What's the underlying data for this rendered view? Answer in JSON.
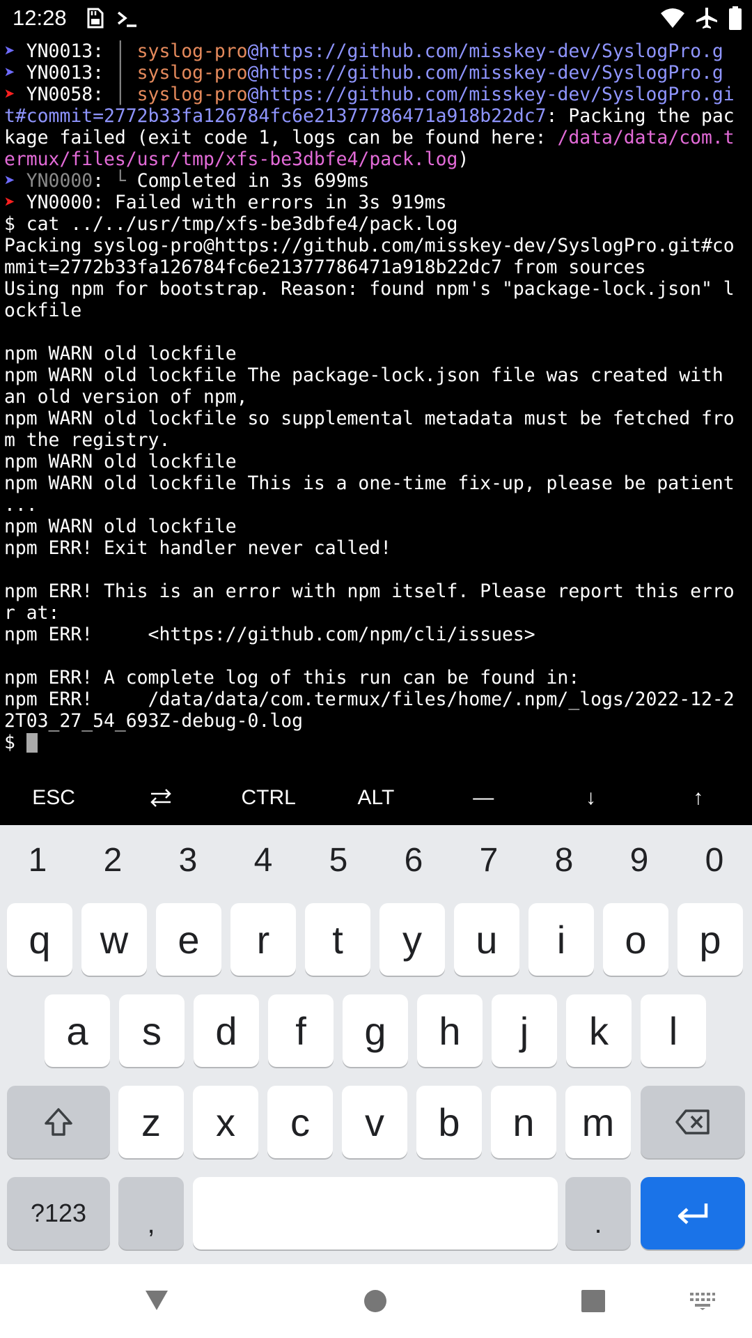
{
  "status_bar": {
    "time": "12:28",
    "left_icons": [
      "sd-card-icon",
      "terminal-prompt-icon"
    ],
    "right_icons": [
      "wifi-icon",
      "airplane-mode-icon",
      "battery-icon"
    ]
  },
  "terminal": {
    "lines": [
      [
        {
          "t": "➤ ",
          "c": "blue"
        },
        {
          "t": "YN0013: "
        },
        {
          "t": "│ ",
          "c": "gray"
        },
        {
          "t": "syslog-pro",
          "c": "orange"
        },
        {
          "t": "@https://github.com/misskey-dev/SyslogPro.g",
          "c": "link"
        }
      ],
      [
        {
          "t": "➤ ",
          "c": "blue"
        },
        {
          "t": "YN0013: "
        },
        {
          "t": "│ ",
          "c": "gray"
        },
        {
          "t": "syslog-pro",
          "c": "orange"
        },
        {
          "t": "@https://github.com/misskey-dev/SyslogPro.g",
          "c": "link"
        }
      ],
      [
        {
          "t": "➤ ",
          "c": "red"
        },
        {
          "t": "YN0058: "
        },
        {
          "t": "│ ",
          "c": "gray"
        },
        {
          "t": "syslog-pro",
          "c": "orange"
        },
        {
          "t": "@https://github.com/misskey-dev/SyslogPro.gi",
          "c": "link"
        }
      ],
      [
        {
          "t": "t#commit=2772b33fa126784fc6e21377786471a918b22dc7",
          "c": "link"
        },
        {
          "t": ": Packing the pac"
        }
      ],
      [
        {
          "t": "kage failed (exit code 1, logs can be found here: "
        },
        {
          "t": "/data/data/com.t",
          "c": "magenta"
        }
      ],
      [
        {
          "t": "ermux/files/usr/tmp/xfs-be3dbfe4/pack.log",
          "c": "magenta"
        },
        {
          "t": ")"
        }
      ],
      [
        {
          "t": "➤ ",
          "c": "blue"
        },
        {
          "t": "YN0000",
          "c": "gray"
        },
        {
          "t": ": "
        },
        {
          "t": "└ ",
          "c": "gray"
        },
        {
          "t": "Completed in 3s 699ms"
        }
      ],
      [
        {
          "t": "➤ ",
          "c": "red"
        },
        {
          "t": "YN0000: Failed with errors in 3s 919ms"
        }
      ],
      [
        {
          "t": "$ cat ../../usr/tmp/xfs-be3dbfe4/pack.log"
        }
      ],
      [
        {
          "t": "Packing syslog-pro@https://github.com/misskey-dev/SyslogPro.git#co"
        }
      ],
      [
        {
          "t": "mmit=2772b33fa126784fc6e21377786471a918b22dc7 from sources"
        }
      ],
      [
        {
          "t": "Using npm for bootstrap. Reason: found npm's \"package-lock.json\" l"
        }
      ],
      [
        {
          "t": "ockfile"
        }
      ],
      [
        {
          "t": ""
        }
      ],
      [
        {
          "t": "npm WARN old lockfile"
        }
      ],
      [
        {
          "t": "npm WARN old lockfile The package-lock.json file was created with"
        }
      ],
      [
        {
          "t": "an old version of npm,"
        }
      ],
      [
        {
          "t": "npm WARN old lockfile so supplemental metadata must be fetched fro"
        }
      ],
      [
        {
          "t": "m the registry."
        }
      ],
      [
        {
          "t": "npm WARN old lockfile"
        }
      ],
      [
        {
          "t": "npm WARN old lockfile This is a one-time fix-up, please be patient"
        }
      ],
      [
        {
          "t": "..."
        }
      ],
      [
        {
          "t": "npm WARN old lockfile"
        }
      ],
      [
        {
          "t": "npm ERR! Exit handler never called!"
        }
      ],
      [
        {
          "t": ""
        }
      ],
      [
        {
          "t": "npm ERR! This is an error with npm itself. Please report this erro"
        }
      ],
      [
        {
          "t": "r at:"
        }
      ],
      [
        {
          "t": "npm ERR!     <https://github.com/npm/cli/issues>"
        }
      ],
      [
        {
          "t": ""
        }
      ],
      [
        {
          "t": "npm ERR! A complete log of this run can be found in:"
        }
      ],
      [
        {
          "t": "npm ERR!     /data/data/com.termux/files/home/.npm/_logs/2022-12-2"
        }
      ],
      [
        {
          "t": "2T03_27_54_693Z-debug-0.log"
        }
      ],
      [
        {
          "t": "$ "
        },
        {
          "cursor": true
        }
      ]
    ]
  },
  "extra_keys": [
    {
      "label": "ESC",
      "name": "esc-key"
    },
    {
      "label": "⇄",
      "name": "tab-key",
      "icon": "tab-arrows-icon"
    },
    {
      "label": "CTRL",
      "name": "ctrl-key"
    },
    {
      "label": "ALT",
      "name": "alt-key"
    },
    {
      "label": "—",
      "name": "dash-key"
    },
    {
      "label": "↓",
      "name": "arrow-down-key"
    },
    {
      "label": "↑",
      "name": "arrow-up-key"
    }
  ],
  "keyboard": {
    "numbers": [
      "1",
      "2",
      "3",
      "4",
      "5",
      "6",
      "7",
      "8",
      "9",
      "0"
    ],
    "row1": [
      "q",
      "w",
      "e",
      "r",
      "t",
      "y",
      "u",
      "i",
      "o",
      "p"
    ],
    "row2": [
      "a",
      "s",
      "d",
      "f",
      "g",
      "h",
      "j",
      "k",
      "l"
    ],
    "row3": [
      "z",
      "x",
      "c",
      "v",
      "b",
      "n",
      "m"
    ],
    "symbols_label": "?123",
    "comma_label": ",",
    "period_label": ".",
    "icons": {
      "shift": "shift-icon",
      "backspace": "backspace-icon",
      "enter": "enter-icon"
    },
    "accent_color": "#1a73e8"
  },
  "nav_bar": {
    "icons": [
      "back-icon",
      "home-icon",
      "recents-icon",
      "keyboard-switch-icon"
    ]
  }
}
